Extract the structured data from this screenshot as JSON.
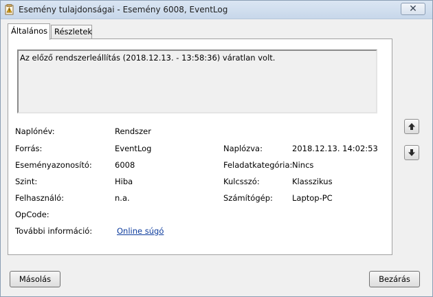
{
  "window": {
    "title": "Esemény tulajdonságai - Esemény 6008, EventLog",
    "close_symbol": "✕"
  },
  "tabs": [
    {
      "label": "Általános",
      "active": true
    },
    {
      "label": "Részletek",
      "active": false
    }
  ],
  "message": "Az előző rendszerleállítás (2018.12.13. - 13:58:36) váratlan volt.",
  "fields_left": [
    {
      "label": "Naplónév:",
      "value": "Rendszer"
    },
    {
      "label": "Forrás:",
      "value": "EventLog"
    },
    {
      "label": "Eseményazonosító:",
      "value": "6008"
    },
    {
      "label": "Szint:",
      "value": "Hiba"
    },
    {
      "label": "Felhasználó:",
      "value": "n.a."
    },
    {
      "label": "OpCode:",
      "value": ""
    },
    {
      "label": "További információ:",
      "value": "Online súgó"
    }
  ],
  "fields_right": [
    {
      "label": "Naplózva:",
      "value": "2018.12.13. 14:02:53"
    },
    {
      "label": "Feladatkategória:",
      "value": "Nincs"
    },
    {
      "label": "Kulcsszó:",
      "value": "Klasszikus"
    },
    {
      "label": "Számítógép:",
      "value": "Laptop-PC"
    }
  ],
  "buttons": {
    "copy": "Másolás",
    "close": "Bezárás"
  },
  "icons": {
    "app": "event-viewer-icon",
    "up": "arrow-up-icon",
    "down": "arrow-down-icon"
  }
}
